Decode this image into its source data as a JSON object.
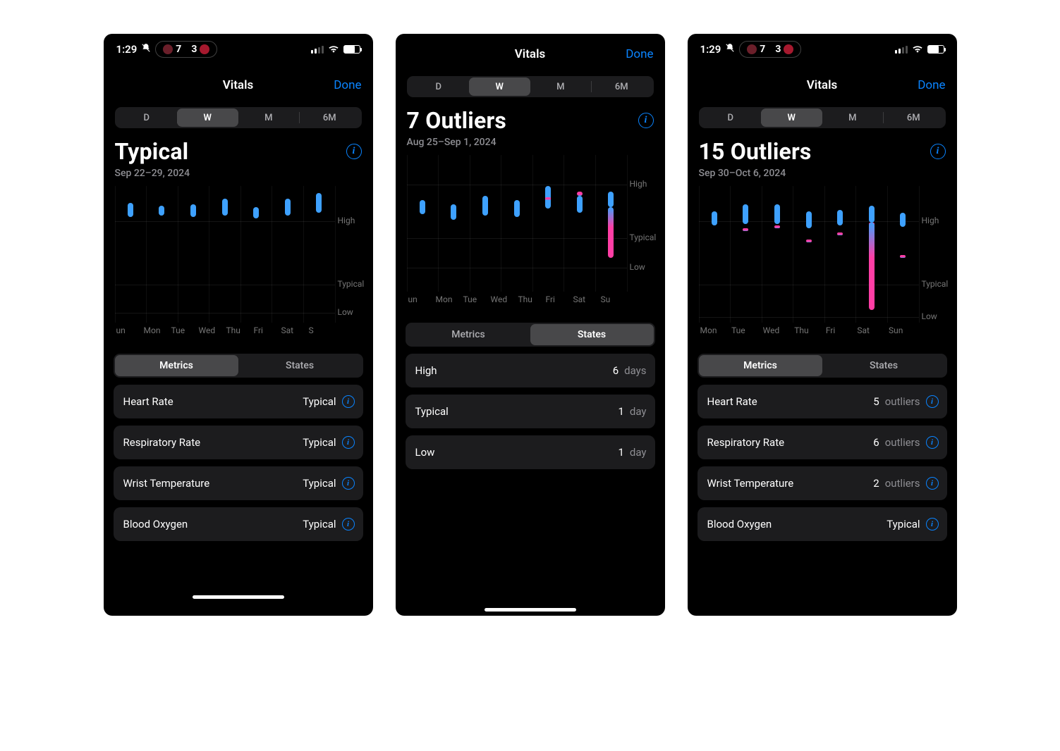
{
  "status_bar": {
    "time": "1:29",
    "left_score_team_color": "#6b1f2a",
    "left_score": "7",
    "right_score_team_color": "#a6192e",
    "right_score": "3"
  },
  "nav": {
    "title": "Vitals",
    "done": "Done"
  },
  "period_segments": [
    "D",
    "W",
    "M",
    "6M"
  ],
  "toggle_labels": {
    "metrics": "Metrics",
    "states": "States"
  },
  "y_levels": {
    "high": "High",
    "typical": "Typical",
    "low": "Low"
  },
  "colors": {
    "blue": "#3ea1ff",
    "pink": "#ff3ea5"
  },
  "screens": [
    {
      "has_status_bar": true,
      "title": "Typical",
      "date_range": "Sep 22–29, 2024",
      "selected_period": "W",
      "selected_toggle": "Metrics",
      "x_labels": [
        "un",
        "Mon",
        "Tue",
        "Wed",
        "Thu",
        "Fri",
        "Sat",
        "S"
      ],
      "y_positions": {
        "high": 50,
        "typical": 140,
        "low": 180
      },
      "chart_data": {
        "type": "bar",
        "bars": [
          {
            "low": 150,
            "high": 170,
            "outlier_low": null,
            "outlier_high": null
          },
          {
            "low": 152,
            "high": 166,
            "outlier_low": null,
            "outlier_high": null
          },
          {
            "low": 150,
            "high": 168,
            "outlier_low": null,
            "outlier_high": null
          },
          {
            "low": 152,
            "high": 176,
            "outlier_low": null,
            "outlier_high": null
          },
          {
            "low": 148,
            "high": 164,
            "outlier_low": null,
            "outlier_high": null
          },
          {
            "low": 152,
            "high": 176,
            "outlier_low": null,
            "outlier_high": null
          },
          {
            "low": 156,
            "high": 184,
            "outlier_low": null,
            "outlier_high": null
          }
        ]
      },
      "list_mode": "metrics",
      "rows": [
        {
          "label": "Heart Rate",
          "value": "Typical",
          "suffix": "",
          "info": true
        },
        {
          "label": "Respiratory Rate",
          "value": "Typical",
          "suffix": "",
          "info": true
        },
        {
          "label": "Wrist Temperature",
          "value": "Typical",
          "suffix": "",
          "info": true
        },
        {
          "label": "Blood Oxygen",
          "value": "Typical",
          "suffix": "",
          "info": true
        }
      ],
      "show_scroll_indicator": true
    },
    {
      "has_status_bar": false,
      "title": "7 Outliers",
      "date_range": "Aug 25–Sep 1, 2024",
      "selected_period": "W",
      "selected_toggle": "States",
      "x_labels": [
        "un",
        "Mon",
        "Tue",
        "Wed",
        "Thu",
        "Fri",
        "Sat",
        "Su"
      ],
      "y_positions": {
        "high": 42,
        "typical": 118,
        "low": 160
      },
      "chart_data": {
        "type": "bar",
        "bars": [
          {
            "low": 110,
            "high": 130,
            "outlier_low": null,
            "outlier_high": null
          },
          {
            "low": 102,
            "high": 124,
            "outlier_low": null,
            "outlier_high": null
          },
          {
            "low": 108,
            "high": 136,
            "outlier_low": null,
            "outlier_high": null
          },
          {
            "low": 106,
            "high": 130,
            "outlier_low": null,
            "outlier_high": null
          },
          {
            "low": 118,
            "high": 150,
            "outlier_low": null,
            "outlier_high": 60
          },
          {
            "low": 112,
            "high": 136,
            "outlier_low": null,
            "outlier_high": 52
          },
          {
            "low": 120,
            "high": 142,
            "outlier_low": 146,
            "outlier_high": 96
          }
        ]
      },
      "list_mode": "states",
      "rows": [
        {
          "label": "High",
          "value": "6",
          "suffix": "days",
          "info": false
        },
        {
          "label": "Typical",
          "value": "1",
          "suffix": "day",
          "info": false
        },
        {
          "label": "Low",
          "value": "1",
          "suffix": "day",
          "info": false
        }
      ],
      "show_home_indicator": true
    },
    {
      "has_status_bar": true,
      "title": "15 Outliers",
      "date_range": "Sep 30–Oct 6, 2024",
      "selected_period": "W",
      "selected_toggle": "Metrics",
      "x_labels": [
        "Mon",
        "Tue",
        "Wed",
        "Thu",
        "Fri",
        "Sat",
        "Sun"
      ],
      "y_positions": {
        "high": 50,
        "typical": 140,
        "low": 186
      },
      "chart_data": {
        "type": "bar",
        "bars": [
          {
            "low": 138,
            "high": 158,
            "outlier_low": null,
            "outlier_high": null
          },
          {
            "low": 140,
            "high": 168,
            "outlier_low": null,
            "outlier_high": 60
          },
          {
            "low": 140,
            "high": 168,
            "outlier_low": null,
            "outlier_high": 56
          },
          {
            "low": 134,
            "high": 158,
            "outlier_low": null,
            "outlier_high": 76
          },
          {
            "low": 138,
            "high": 160,
            "outlier_low": null,
            "outlier_high": 66
          },
          {
            "low": 142,
            "high": 166,
            "outlier_low": 176,
            "outlier_high": 52
          },
          {
            "low": 136,
            "high": 156,
            "outlier_low": null,
            "outlier_high": 98
          }
        ]
      },
      "list_mode": "metrics",
      "rows": [
        {
          "label": "Heart Rate",
          "value": "5",
          "suffix": "outliers",
          "info": true
        },
        {
          "label": "Respiratory Rate",
          "value": "6",
          "suffix": "outliers",
          "info": true
        },
        {
          "label": "Wrist Temperature",
          "value": "2",
          "suffix": "outliers",
          "info": true
        },
        {
          "label": "Blood Oxygen",
          "value": "Typical",
          "suffix": "",
          "info": true
        }
      ]
    }
  ]
}
